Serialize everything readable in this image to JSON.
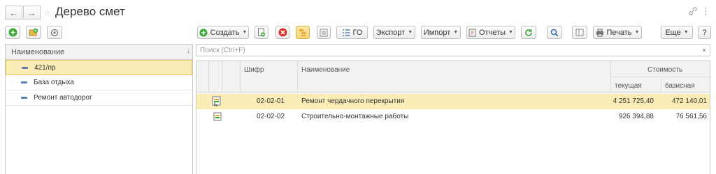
{
  "window": {
    "title": "Дерево смет",
    "back_icon": "arrow-left-icon",
    "forward_icon": "arrow-right-icon",
    "star_icon": "star-icon",
    "link_icon": "link-icon",
    "more_icon": "more-vertical-icon",
    "close_icon": "close-icon"
  },
  "left_toolbar": {
    "buttons": [
      "add-icon",
      "add-folder-icon",
      "settings-icon"
    ]
  },
  "toolbar": {
    "create_label": "Создать",
    "go_label": "ГО",
    "export_label": "Экспорт",
    "import_label": "Импорт",
    "reports_label": "Отчеты",
    "print_label": "Печать",
    "more_label": "Еще",
    "help_label": "?"
  },
  "left_panel": {
    "header": "Наименование",
    "sort_indicator": "↓",
    "items": [
      {
        "label": "421/пр",
        "selected": true
      },
      {
        "label": "База отдыха",
        "selected": false
      },
      {
        "label": "Ремонт автодорог",
        "selected": false
      }
    ]
  },
  "search": {
    "placeholder": "Поиск (Ctrl+F)",
    "clear": "×"
  },
  "table": {
    "columns": {
      "code": "Шифр",
      "name": "Наименование",
      "cost": "Стоимость",
      "current": "текущая",
      "base": "базисная"
    },
    "rows": [
      {
        "code": "02-02-01",
        "name": "Ремонт чердачного перекрытия",
        "current": "4 251 725,40",
        "base": "472 140,01",
        "selected": true
      },
      {
        "code": "02-02-02",
        "name": "Строительно-монтажные работы",
        "current": "926 394,88",
        "base": "76 561,56",
        "selected": false
      }
    ]
  },
  "colors": {
    "accent_green": "#3aa935",
    "selection": "#fbecb5",
    "delete_red": "#d9312c"
  }
}
